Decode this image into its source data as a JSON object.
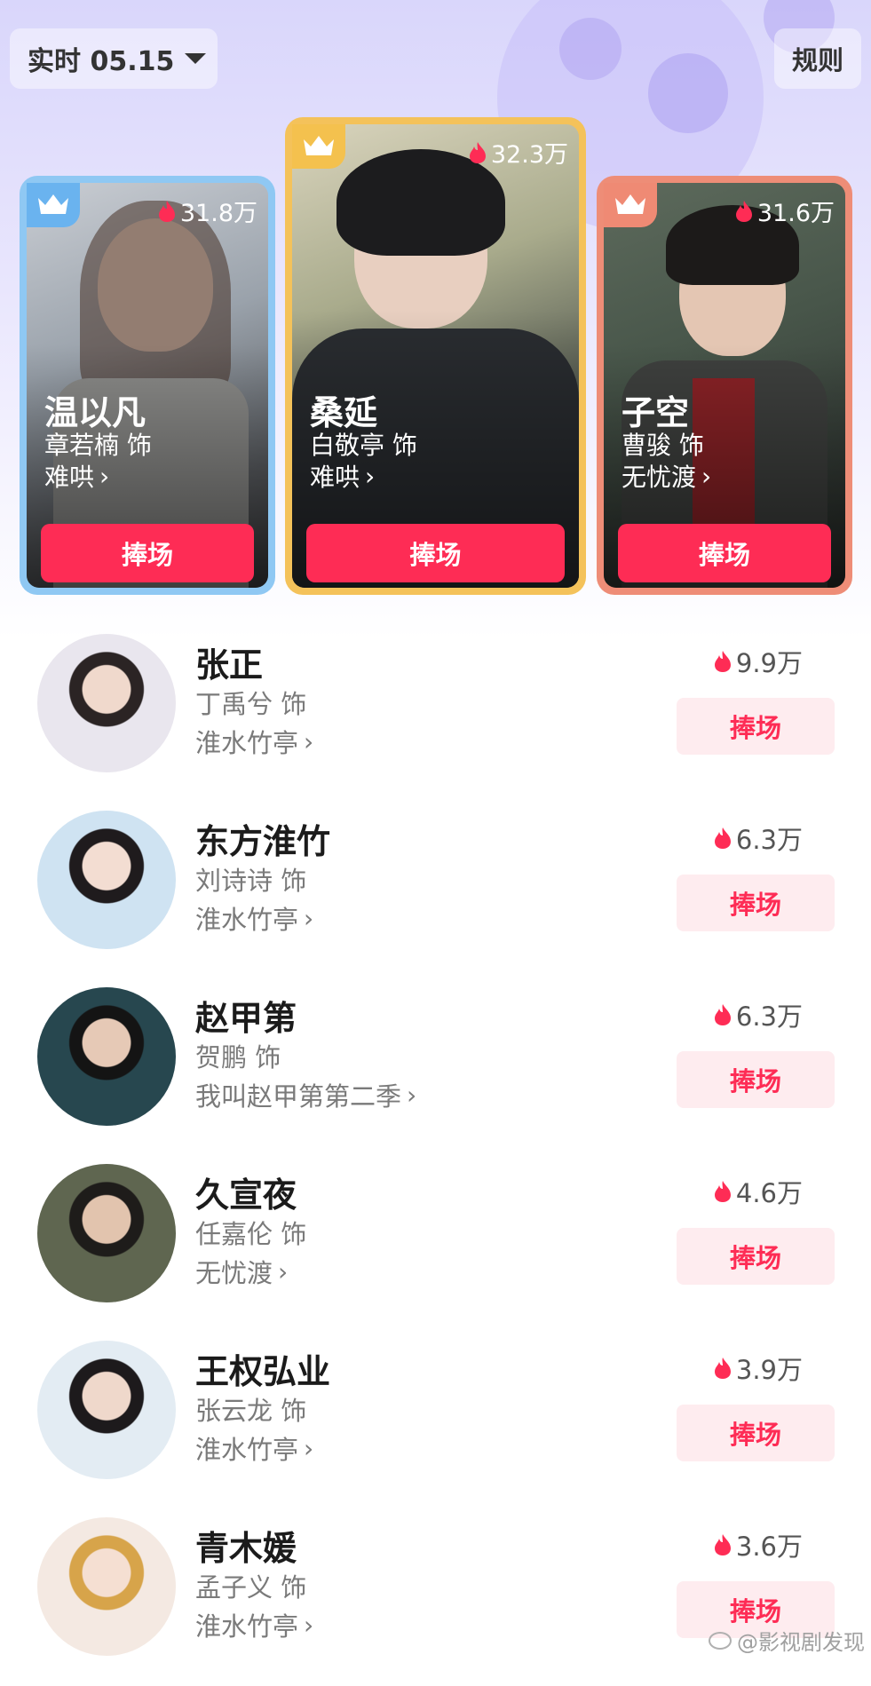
{
  "header": {
    "date_label": "实时 05.15",
    "rules_label": "规则"
  },
  "podium": [
    {
      "rank": 2,
      "role": "温以凡",
      "actor": "章若楠 饰",
      "drama": "难哄",
      "heat": "31.8万",
      "button": "捧场",
      "crown_color": "#6ab3ef"
    },
    {
      "rank": 1,
      "role": "桑延",
      "actor": "白敬亭 饰",
      "drama": "难哄",
      "heat": "32.3万",
      "button": "捧场",
      "crown_color": "#f4c14e"
    },
    {
      "rank": 3,
      "role": "子空",
      "actor": "曹骏 饰",
      "drama": "无忧渡",
      "heat": "31.6万",
      "button": "捧场",
      "crown_color": "#ef8a74"
    }
  ],
  "list": [
    {
      "role": "张正",
      "actor": "丁禹兮 饰",
      "drama": "淮水竹亭",
      "heat": "9.9万",
      "button": "捧场"
    },
    {
      "role": "东方淮竹",
      "actor": "刘诗诗 饰",
      "drama": "淮水竹亭",
      "heat": "6.3万",
      "button": "捧场"
    },
    {
      "role": "赵甲第",
      "actor": "贺鹏 饰",
      "drama": "我叫赵甲第第二季",
      "heat": "6.3万",
      "button": "捧场"
    },
    {
      "role": "久宣夜",
      "actor": "任嘉伦 饰",
      "drama": "无忧渡",
      "heat": "4.6万",
      "button": "捧场"
    },
    {
      "role": "王权弘业",
      "actor": "张云龙 饰",
      "drama": "淮水竹亭",
      "heat": "3.9万",
      "button": "捧场"
    },
    {
      "role": "青木媛",
      "actor": "孟子义 饰",
      "drama": "淮水竹亭",
      "heat": "3.6万",
      "button": "捧场"
    }
  ],
  "watermark": "@影视剧发现",
  "colors": {
    "accent": "#fe2c55",
    "button_soft": "#feecef",
    "flame": "#fe2c55"
  }
}
